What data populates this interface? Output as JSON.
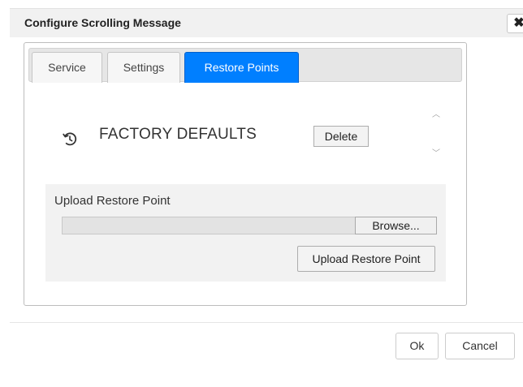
{
  "dialog": {
    "title": "Configure Scrolling Message",
    "close_icon": "close-icon (✖)"
  },
  "tabs": [
    {
      "label": "Service",
      "active": false
    },
    {
      "label": "Settings",
      "active": false
    },
    {
      "label": "Restore Points",
      "active": true
    }
  ],
  "restore_points": [
    {
      "name": "FACTORY DEFAULTS",
      "icon": "restore-icon",
      "delete_label": "Delete"
    }
  ],
  "upload": {
    "label": "Upload Restore Point",
    "browse_label": "Browse...",
    "file_value": "",
    "upload_button_label": "Upload Restore Point"
  },
  "footer": {
    "ok_label": "Ok",
    "cancel_label": "Cancel"
  },
  "colors": {
    "accent": "#007fff",
    "titlebar": "#f1f1f1",
    "upload_bg": "#f2f2f2"
  }
}
